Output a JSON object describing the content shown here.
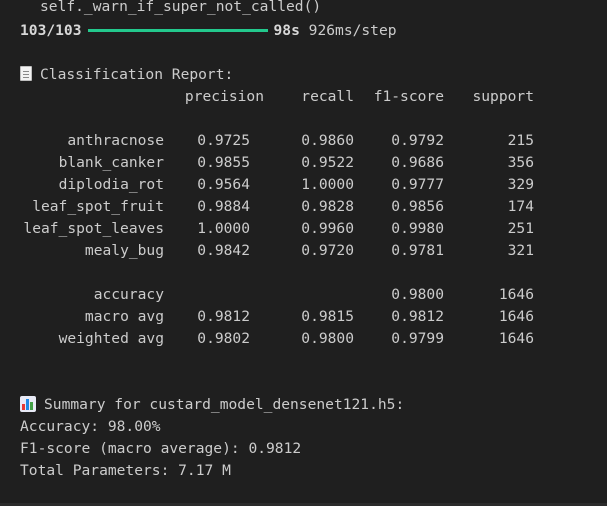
{
  "top_line": "self._warn_if_super_not_called()",
  "progress": {
    "step": "103/103",
    "fraction": 1.0,
    "time": "98s",
    "per_step": "926ms/step"
  },
  "report": {
    "icon": "document-icon",
    "title": "Classification Report:",
    "headers": [
      "precision",
      "recall",
      "f1-score",
      "support"
    ],
    "rows": [
      {
        "label": "anthracnose",
        "precision": "0.9725",
        "recall": "0.9860",
        "f1": "0.9792",
        "support": "215"
      },
      {
        "label": "blank_canker",
        "precision": "0.9855",
        "recall": "0.9522",
        "f1": "0.9686",
        "support": "356"
      },
      {
        "label": "diplodia_rot",
        "precision": "0.9564",
        "recall": "1.0000",
        "f1": "0.9777",
        "support": "329"
      },
      {
        "label": "leaf_spot_fruit",
        "precision": "0.9884",
        "recall": "0.9828",
        "f1": "0.9856",
        "support": "174"
      },
      {
        "label": "leaf_spot_leaves",
        "precision": "1.0000",
        "recall": "0.9960",
        "f1": "0.9980",
        "support": "251"
      },
      {
        "label": "mealy_bug",
        "precision": "0.9842",
        "recall": "0.9720",
        "f1": "0.9781",
        "support": "321"
      }
    ],
    "summary_rows": [
      {
        "label": "accuracy",
        "precision": "",
        "recall": "",
        "f1": "0.9800",
        "support": "1646"
      },
      {
        "label": "macro avg",
        "precision": "0.9812",
        "recall": "0.9815",
        "f1": "0.9812",
        "support": "1646"
      },
      {
        "label": "weighted avg",
        "precision": "0.9802",
        "recall": "0.9800",
        "f1": "0.9799",
        "support": "1646"
      }
    ]
  },
  "summary": {
    "icon": "bar-chart-icon",
    "title": "Summary for custard_model_densenet121.h5:",
    "accuracy_line": "Accuracy: 98.00%",
    "f1_line": "F1-score (macro average): 0.9812",
    "params_line": "Total Parameters: 7.17 M"
  },
  "colors": {
    "background": "#1f1f1f",
    "text": "#cccccc",
    "progress": "#23c98d"
  }
}
